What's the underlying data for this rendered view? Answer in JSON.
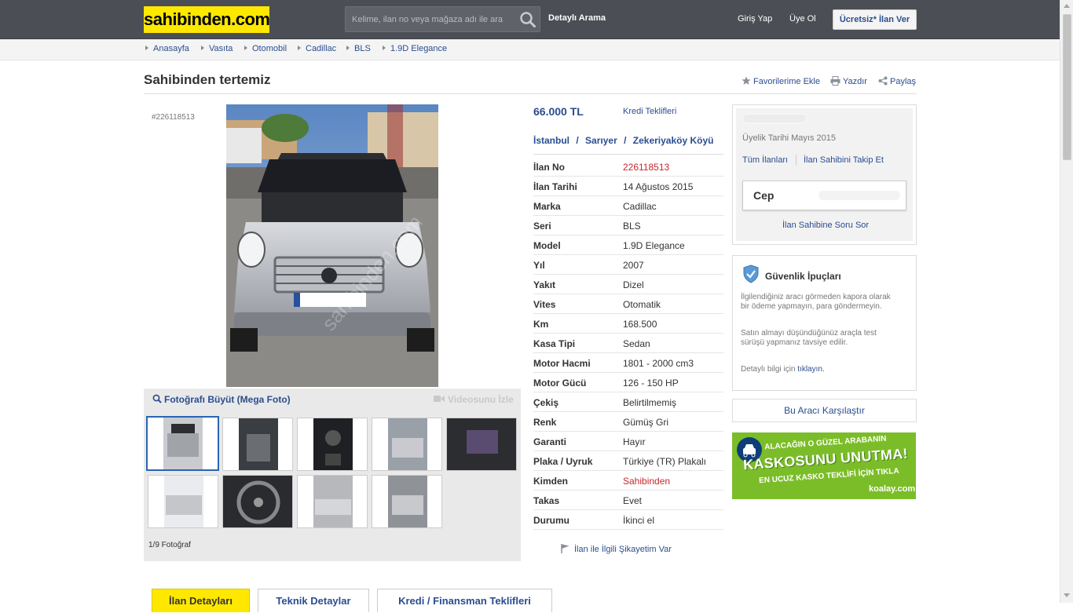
{
  "header": {
    "logo": "sahibinden.com",
    "search_placeholder": "Kelime, ilan no veya mağaza adı ile ara",
    "detailed_search": "Detaylı Arama",
    "login": "Giriş Yap",
    "register": "Üye Ol",
    "post_ad": "Ücretsiz* İlan Ver"
  },
  "breadcrumb": [
    "Anasayfa",
    "Vasıta",
    "Otomobil",
    "Cadillac",
    "BLS",
    "1.9D Elegance"
  ],
  "listing": {
    "title": "Sahibinden tertemiz",
    "id_label": "#226118513",
    "actions": {
      "favorite": "Favorilerime Ekle",
      "print": "Yazdır",
      "share": "Paylaş"
    }
  },
  "gallery": {
    "mega_photo": "Fotoğrafı Büyüt (Mega Foto)",
    "video": "Videosunu İzle",
    "counter": "1/9 Fotoğraf"
  },
  "info": {
    "price": "66.000 TL",
    "credit": "Kredi Teklifleri",
    "location": [
      "İstanbul",
      "Sarıyer",
      "Zekeriyaköy Köyü"
    ],
    "location_sep": "/",
    "rows": [
      {
        "key": "İlan No",
        "value": "226118513"
      },
      {
        "key": "İlan Tarihi",
        "value": "14 Ağustos 2015"
      },
      {
        "key": "Marka",
        "value": "Cadillac"
      },
      {
        "key": "Seri",
        "value": "BLS"
      },
      {
        "key": "Model",
        "value": "1.9D Elegance"
      },
      {
        "key": "Yıl",
        "value": "2007"
      },
      {
        "key": "Yakıt",
        "value": "Dizel"
      },
      {
        "key": "Vites",
        "value": "Otomatik"
      },
      {
        "key": "Km",
        "value": "168.500"
      },
      {
        "key": "Kasa Tipi",
        "value": "Sedan"
      },
      {
        "key": "Motor Hacmi",
        "value": "1801 - 2000 cm3"
      },
      {
        "key": "Motor Gücü",
        "value": "126 - 150 HP"
      },
      {
        "key": "Çekiş",
        "value": "Belirtilmemiş"
      },
      {
        "key": "Renk",
        "value": "Gümüş Gri"
      },
      {
        "key": "Garanti",
        "value": "Hayır"
      },
      {
        "key": "Plaka / Uyruk",
        "value": "Türkiye (TR) Plakalı"
      },
      {
        "key": "Kimden",
        "value": "Sahibinden"
      },
      {
        "key": "Takas",
        "value": "Evet"
      },
      {
        "key": "Durumu",
        "value": "İkinci el"
      }
    ],
    "complaint": "İlan ile İlgili Şikayetim Var"
  },
  "seller": {
    "membership": "Üyelik Tarihi  Mayıs 2015",
    "all_ads": "Tüm İlanları",
    "follow": "İlan Sahibini Takip Et",
    "phone_label": "Cep",
    "ask": "İlan Sahibine Soru Sor"
  },
  "safety": {
    "title": "Güvenlik İpuçları",
    "tip1": "İlgilendiğiniz aracı görmeden kapora olarak bir ödeme yapmayın, para göndermeyin.",
    "tip2": "Satın almayı düşündüğünüz araçla test sürüşü yapmanız tavsiye edilir.",
    "more_prefix": "Detaylı bilgi için",
    "more_link": "tıklayın."
  },
  "compare": "Bu Aracı Karşılaştır",
  "ad_banner": {
    "line1": "ALACAĞIN O GÜZEL ARABANIN",
    "line2": "KASKOSUNU UNUTMA!",
    "line3": "EN UCUZ KASKO TEKLİFİ İÇİN TIKLA",
    "brand": "koalay.com"
  },
  "tabs": [
    "İlan Detayları",
    "Teknik Detaylar",
    "Kredi / Finansman Teklifleri"
  ],
  "colors": {
    "brand_yellow": "#ffe800",
    "link_blue": "#2a4d8f",
    "header_gray": "#4b4e54",
    "red": "#c8252c"
  }
}
